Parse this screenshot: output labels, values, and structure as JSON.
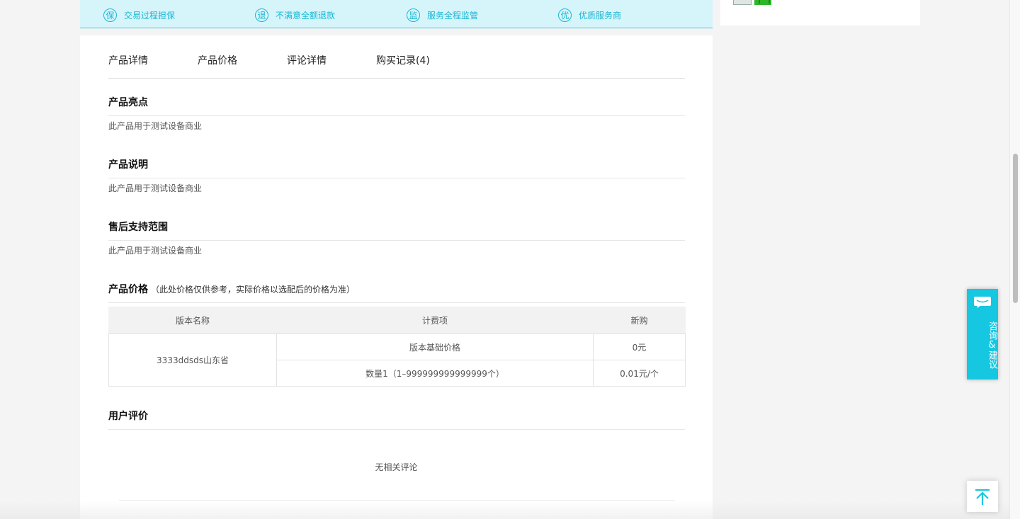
{
  "guarantees": [
    {
      "icon_char": "保",
      "icon": "guarantee-icon",
      "label": "交易过程担保"
    },
    {
      "icon_char": "退",
      "icon": "refund-icon",
      "label": "不满意全额退款"
    },
    {
      "icon_char": "监",
      "icon": "supervise-icon",
      "label": "服务全程监管"
    },
    {
      "icon_char": "优",
      "icon": "quality-icon",
      "label": "优质服务商"
    }
  ],
  "tabs": [
    {
      "label": "产品详情"
    },
    {
      "label": "产品价格"
    },
    {
      "label": "评论详情"
    },
    {
      "label": "购买记录(4)"
    }
  ],
  "sections": {
    "highlights": {
      "title": "产品亮点",
      "text": "此产品用于测试设备商业"
    },
    "description": {
      "title": "产品说明",
      "text": "此产品用于测试设备商业"
    },
    "after_sales": {
      "title": "售后支持范围",
      "text": "此产品用于测试设备商业"
    },
    "price": {
      "title": "产品价格",
      "note": "（此处价格仅供参考，实际价格以选配后的价格为准）"
    },
    "reviews": {
      "title": "用户评价",
      "empty_text": "无相关评论"
    }
  },
  "price_table": {
    "headers": [
      "版本名称",
      "计费项",
      "新购"
    ],
    "version_name": "3333ddsds山东省",
    "rows": [
      {
        "item": "版本基础价格",
        "price": "0元"
      },
      {
        "item": "数量1（1–999999999999999个）",
        "price": "0.01元/个"
      }
    ]
  },
  "floating": {
    "consult_label": "咨询&建议",
    "consult_icon": "chat-icon",
    "to_top_icon": "arrow-up-icon"
  },
  "colors": {
    "accent": "#16c7e1",
    "guarantee_bg": "#d5f5fb",
    "guarantee_text": "#19b6d3"
  }
}
